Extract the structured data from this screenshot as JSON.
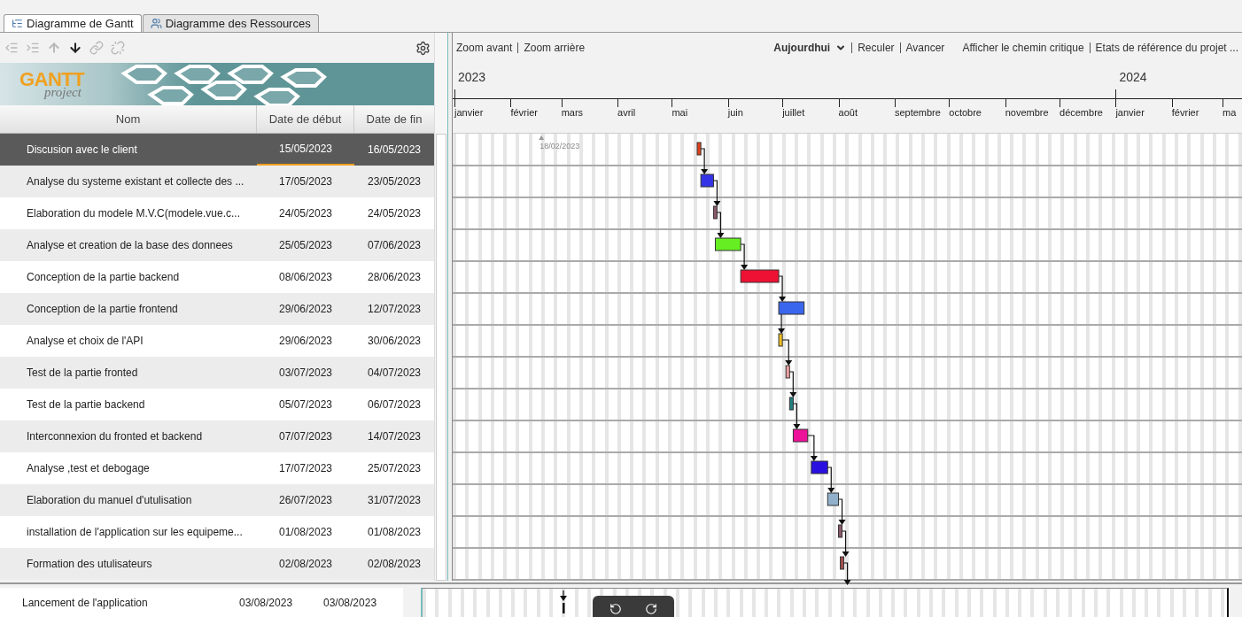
{
  "tabs": [
    {
      "label": "Diagramme de Gantt",
      "kind": "gantt",
      "selected": true
    },
    {
      "label": "Diagramme des Ressources",
      "kind": "resources",
      "selected": false
    }
  ],
  "toolbar": [
    {
      "kind": "outdent",
      "disabled": true
    },
    {
      "kind": "indent",
      "disabled": true
    },
    {
      "kind": "up",
      "disabled": true
    },
    {
      "kind": "down",
      "disabled": false
    },
    {
      "kind": "link",
      "disabled": true
    },
    {
      "kind": "unlink",
      "disabled": true
    }
  ],
  "logo": {
    "title": "GANTT",
    "subtitle": "project"
  },
  "table": {
    "columns": [
      "Nom",
      "Date de début",
      "Date de fin"
    ],
    "rows": [
      {
        "name": "Discusion avec le client",
        "start": "15/05/2023",
        "end": "16/05/2023",
        "selected": true,
        "color": "#e0401a"
      },
      {
        "name": "Analyse du systeme existant et collecte des ...",
        "start": "17/05/2023",
        "end": "23/05/2023",
        "selected": false,
        "color": "#3434e6"
      },
      {
        "name": "Elaboration du modele M.V.C(modele.vue.c...",
        "start": "24/05/2023",
        "end": "24/05/2023",
        "selected": false,
        "color": "#8a5a6a"
      },
      {
        "name": "Analyse et creation de la base des donnees",
        "start": "25/05/2023",
        "end": "07/06/2023",
        "selected": false,
        "color": "#66ee22"
      },
      {
        "name": "Conception de la partie backend",
        "start": "08/06/2023",
        "end": "28/06/2023",
        "selected": false,
        "color": "#ee1133"
      },
      {
        "name": "Conception de la partie frontend",
        "start": "29/06/2023",
        "end": "12/07/2023",
        "selected": false,
        "color": "#3a66ee"
      },
      {
        "name": "Analyse et choix de l'API",
        "start": "29/06/2023",
        "end": "30/06/2023",
        "selected": false,
        "color": "#f0c020"
      },
      {
        "name": "Test de la partie fronted",
        "start": "03/07/2023",
        "end": "04/07/2023",
        "selected": false,
        "color": "#f0a0a0"
      },
      {
        "name": "Test de la partie backend",
        "start": "05/07/2023",
        "end": "06/07/2023",
        "selected": false,
        "color": "#208080"
      },
      {
        "name": "Interconnexion du fronted et backend",
        "start": "07/07/2023",
        "end": "14/07/2023",
        "selected": false,
        "color": "#ee1199"
      },
      {
        "name": "Analyse ,test et debogage",
        "start": "17/07/2023",
        "end": "25/07/2023",
        "selected": false,
        "color": "#2a10e0"
      },
      {
        "name": "Elaboration du manuel d'utulisation",
        "start": "26/07/2023",
        "end": "31/07/2023",
        "selected": false,
        "color": "#90b0cc"
      },
      {
        "name": "installation de l'application sur les equipeme...",
        "start": "01/08/2023",
        "end": "01/08/2023",
        "selected": false,
        "color": "#8a5a6a"
      },
      {
        "name": "Formation des utulisateurs",
        "start": "02/08/2023",
        "end": "02/08/2023",
        "selected": false,
        "color": "#a05050"
      }
    ]
  },
  "chart": {
    "links_left": [
      "Zoom avant",
      "Zoom arrière"
    ],
    "today": "Aujourdhui",
    "links_right": [
      "Reculer",
      "Avancer"
    ],
    "links_far": [
      "Afficher le chemin critique",
      "Etats de référence du projet ..."
    ],
    "years": [
      {
        "label": "2023",
        "months": [
          "janvier",
          "février",
          "mars",
          "avril",
          "mai",
          "juin",
          "juillet",
          "août",
          "septembre",
          "octobre",
          "novembre",
          "décembre"
        ]
      },
      {
        "label": "2024",
        "months": [
          "janvier",
          "février",
          "ma"
        ]
      }
    ],
    "marker": "18/02/2023"
  },
  "bottom_row": {
    "name": "Lancement de l'application",
    "start": "03/08/2023",
    "end": "03/08/2023"
  }
}
